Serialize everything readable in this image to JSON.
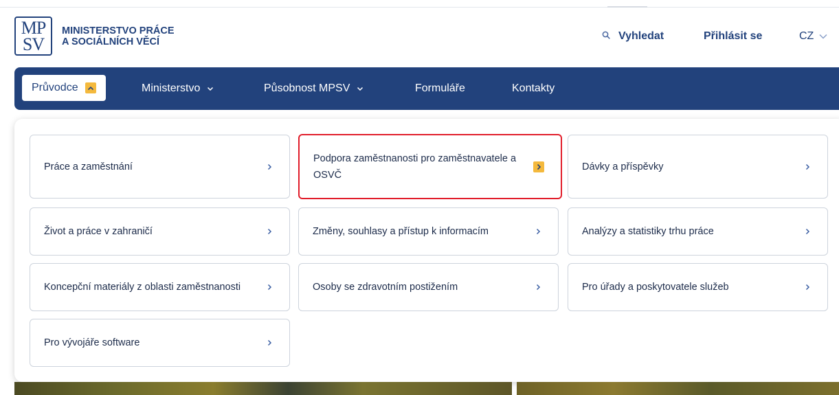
{
  "header": {
    "logo_letters_top": "MP",
    "logo_letters_bottom": "SV",
    "org_line1": "MINISTERSTVO PRÁCE",
    "org_line2": "A SOCIÁLNÍCH VĚCÍ",
    "search_label": "Vyhledat",
    "login_label": "Přihlásit se",
    "lang_label": "CZ"
  },
  "nav": {
    "items": [
      {
        "label": "Průvodce",
        "active": true
      },
      {
        "label": "Ministerstvo"
      },
      {
        "label": "Působnost MPSV"
      },
      {
        "label": "Formuláře"
      },
      {
        "label": "Kontakty"
      }
    ]
  },
  "menu": {
    "cards": [
      {
        "label": "Práce a zaměstnání"
      },
      {
        "label": "Podpora zaměstnanosti pro zaměstnavatele a OSVČ",
        "highlighted": true
      },
      {
        "label": "Dávky a příspěvky"
      },
      {
        "label": "Život a práce v zahraničí"
      },
      {
        "label": "Změny, souhlasy a přístup k informacím"
      },
      {
        "label": "Analýzy a statistiky trhu práce"
      },
      {
        "label": "Koncepční materiály z oblasti zaměstnanosti"
      },
      {
        "label": "Osoby se zdravotním postižením"
      },
      {
        "label": "Pro úřady a poskytovatele služeb"
      },
      {
        "label": "Pro vývojáře software"
      }
    ]
  },
  "colors": {
    "brand": "#22427c",
    "accent": "#f4b93d",
    "highlight_border": "#e11d2a"
  }
}
